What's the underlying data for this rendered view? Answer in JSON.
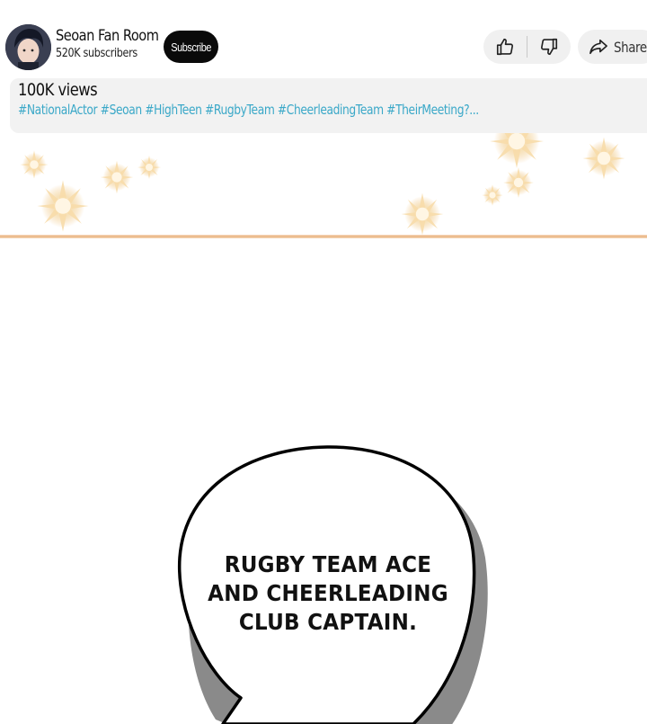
{
  "channel": {
    "name": "Seoan Fan Room",
    "subscribers": "520K subscribers",
    "subscribe_label": "Subscribe",
    "avatar_icon": "person-avatar-icon"
  },
  "actions": {
    "like_icon": "thumbs-up-icon",
    "dislike_icon": "thumbs-down-icon",
    "share_icon": "share-arrow-icon",
    "share_label": "Share"
  },
  "description": {
    "views": "100K views",
    "hashtags": "#NationalActor #Seoan #HighTeen #RugbyTeam #CheerleadingTeam #TheirMeeting?..."
  },
  "comic": {
    "speech_lines": [
      "RUGBY TEAM ACE",
      "AND CHEERLEADING",
      "CLUB CAPTAIN."
    ]
  },
  "colors": {
    "hashtag": "#3aa8c8",
    "subscribe_bg": "#0a0a0a",
    "divider_line": "#e9b27e",
    "sparkle": "#f5d9a8"
  }
}
